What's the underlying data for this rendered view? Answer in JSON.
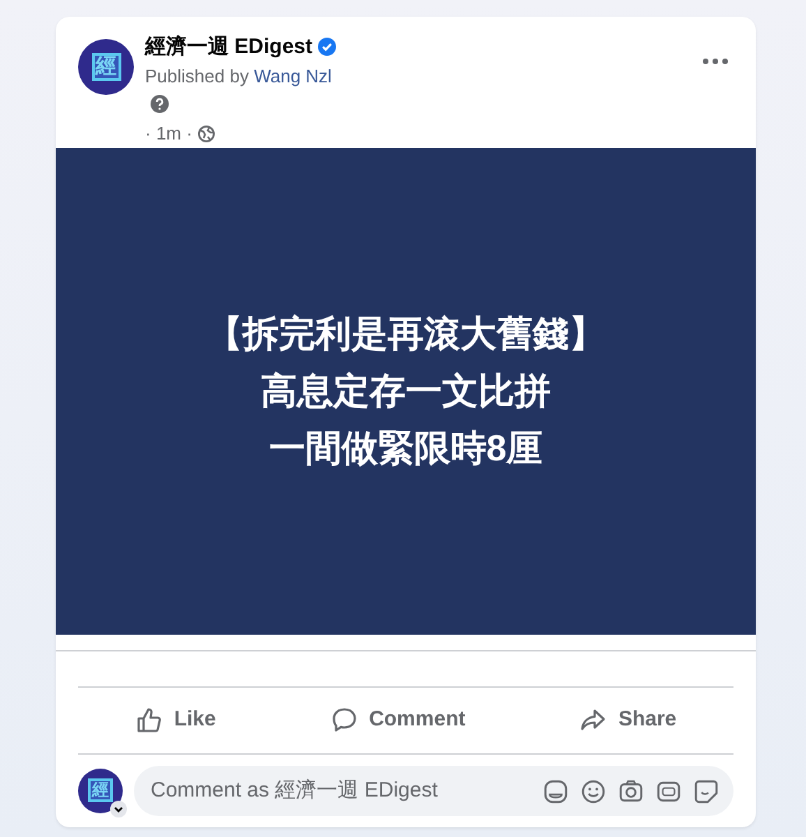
{
  "post": {
    "avatar_text": "經",
    "page_name": "經濟一週 EDigest",
    "verified": true,
    "published_by": "Published by",
    "author": "Wang Nzl",
    "time": "· 1m ·",
    "image_lines": [
      "【拆完利是再滾大舊錢】",
      "高息定存一文比拼",
      "一間做緊限時8厘"
    ]
  },
  "actions": [
    {
      "label": "Like",
      "kind": "like"
    },
    {
      "label": "Comment",
      "kind": "comment"
    },
    {
      "label": "Share",
      "kind": "share"
    }
  ],
  "comment_box": {
    "avatar_text": "經",
    "placeholder": "Comment as 經濟一週 EDigest"
  }
}
